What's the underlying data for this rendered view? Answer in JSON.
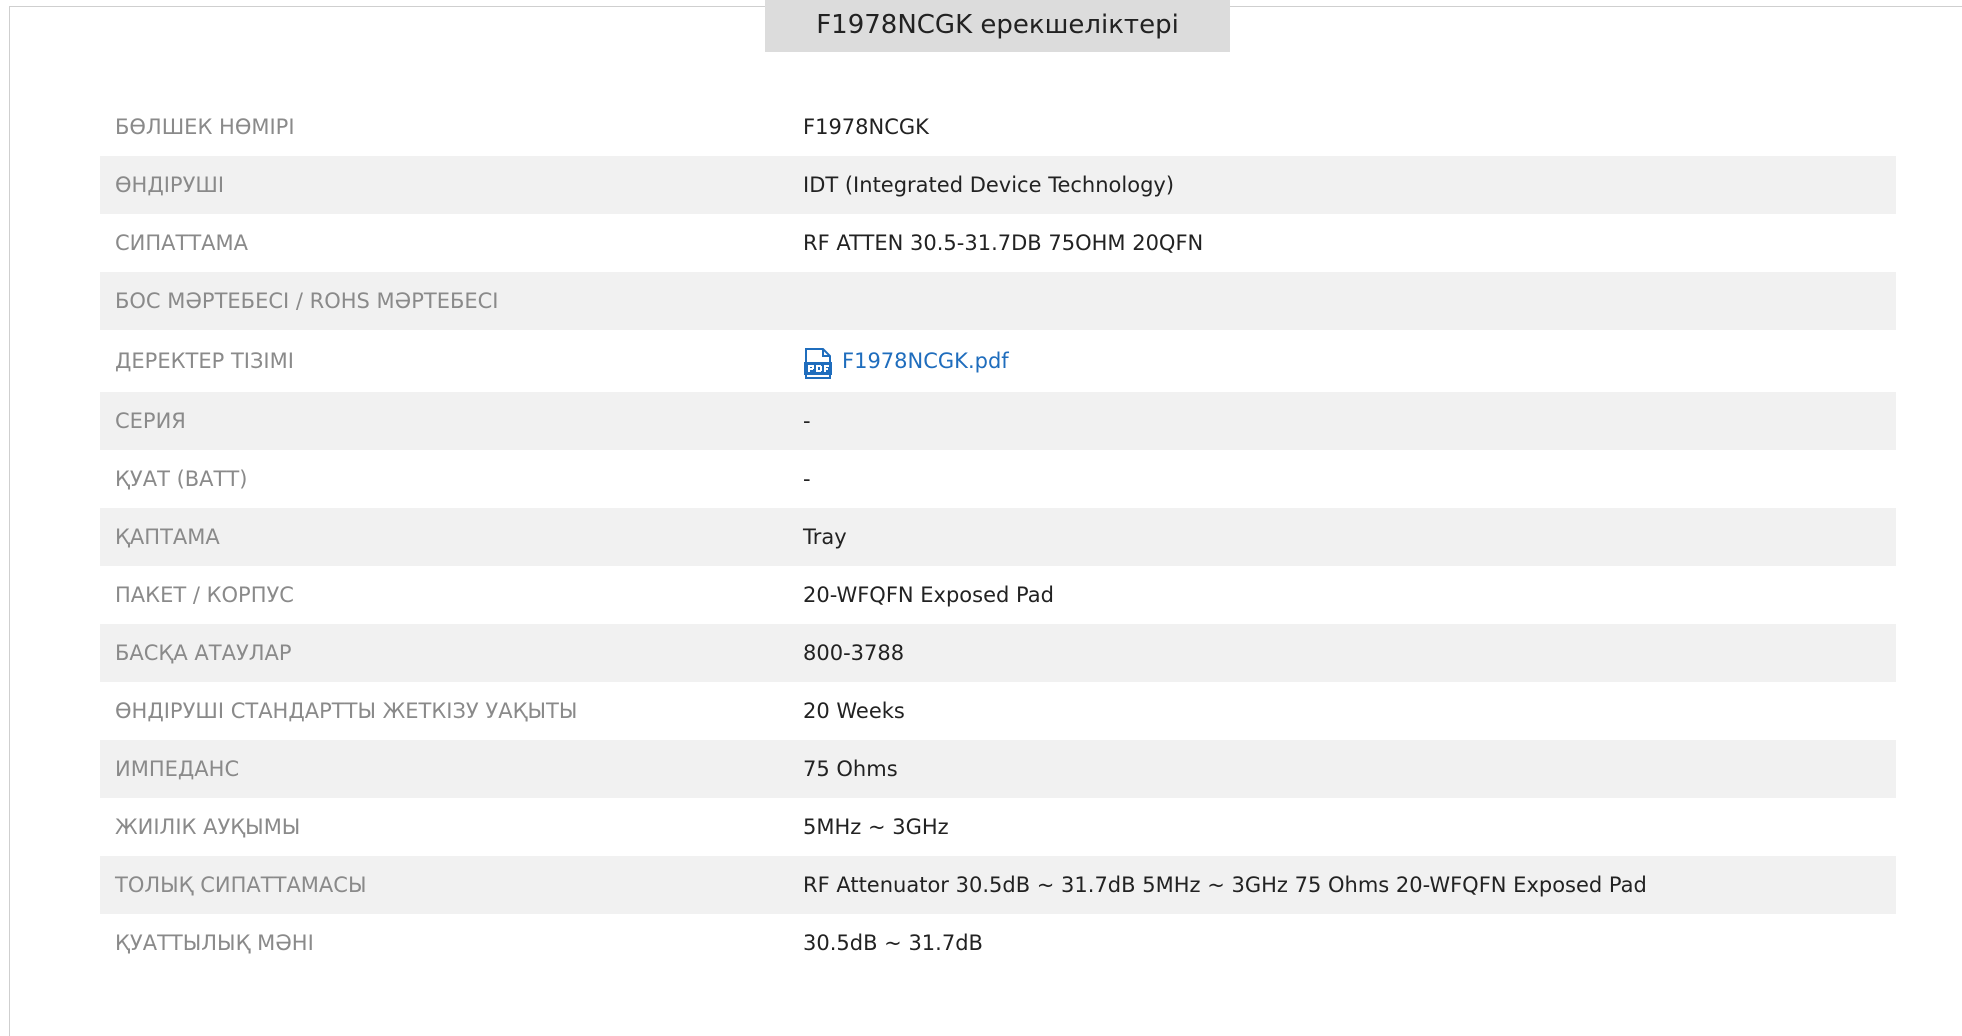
{
  "header": {
    "title": "F1978NCGK ерекшеліктері"
  },
  "specs": [
    {
      "label": "БӨЛШЕК НӨМІРІ",
      "value": "F1978NCGK"
    },
    {
      "label": "ӨНДІРУШІ",
      "value": "IDT (Integrated Device Technology)"
    },
    {
      "label": "СИПАТТАМА",
      "value": "RF ATTEN 30.5-31.7DB 75OHM 20QFN"
    },
    {
      "label": "БОС МӘРТЕБЕСІ / ROHS МӘРТЕБЕСІ",
      "value": ""
    },
    {
      "label": "ДЕРЕКТЕР ТІЗІМІ",
      "value": "F1978NCGK.pdf",
      "icon": "pdf-icon"
    },
    {
      "label": "СЕРИЯ",
      "value": "-"
    },
    {
      "label": "ҚУАТ (ВАТТ)",
      "value": "-"
    },
    {
      "label": "ҚАПТАМА",
      "value": "Tray"
    },
    {
      "label": "ПАКЕТ / КОРПУС",
      "value": "20-WFQFN Exposed Pad"
    },
    {
      "label": "БАСҚА АТАУЛАР",
      "value": "800-3788"
    },
    {
      "label": "ӨНДІРУШІ СТАНДАРТТЫ ЖЕТКІЗУ УАҚЫТЫ",
      "value": "20 Weeks"
    },
    {
      "label": "ИМПЕДАНС",
      "value": "75 Ohms"
    },
    {
      "label": "ЖИІЛІК АУҚЫМЫ",
      "value": "5MHz ~ 3GHz"
    },
    {
      "label": "ТОЛЫҚ СИПАТТАМАСЫ",
      "value": "RF Attenuator 30.5dB ~ 31.7dB 5MHz ~ 3GHz 75 Ohms 20-WFQFN Exposed Pad"
    },
    {
      "label": "ҚУАТТЫЛЫҚ МӘНІ",
      "value": "30.5dB ~ 31.7dB"
    }
  ],
  "colors": {
    "label_text": "#8a8a8a",
    "value_text": "#222222",
    "link": "#1f6dbd",
    "row_alt_bg": "#f1f1f1",
    "title_bg": "#dcdcdc"
  }
}
